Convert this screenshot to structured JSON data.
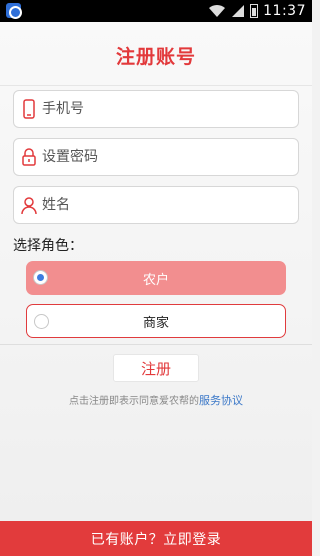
{
  "status_bar": {
    "time": "11:37"
  },
  "header": {
    "title": "注册账号"
  },
  "form": {
    "phone_placeholder": "手机号",
    "password_placeholder": "设置密码",
    "name_placeholder": "姓名"
  },
  "role": {
    "label": "选择角色：",
    "options": [
      {
        "label": "农户",
        "selected": true
      },
      {
        "label": "商家",
        "selected": false
      }
    ]
  },
  "actions": {
    "register_label": "注册",
    "agreement_text": "点击注册即表示同意爱农帮的",
    "agreement_link": "服务协议",
    "login_prompt": "已有账户？立即登录"
  },
  "colors": {
    "accent": "#e2393b",
    "selected_role": "#f28e8f",
    "link": "#3b78c8"
  }
}
